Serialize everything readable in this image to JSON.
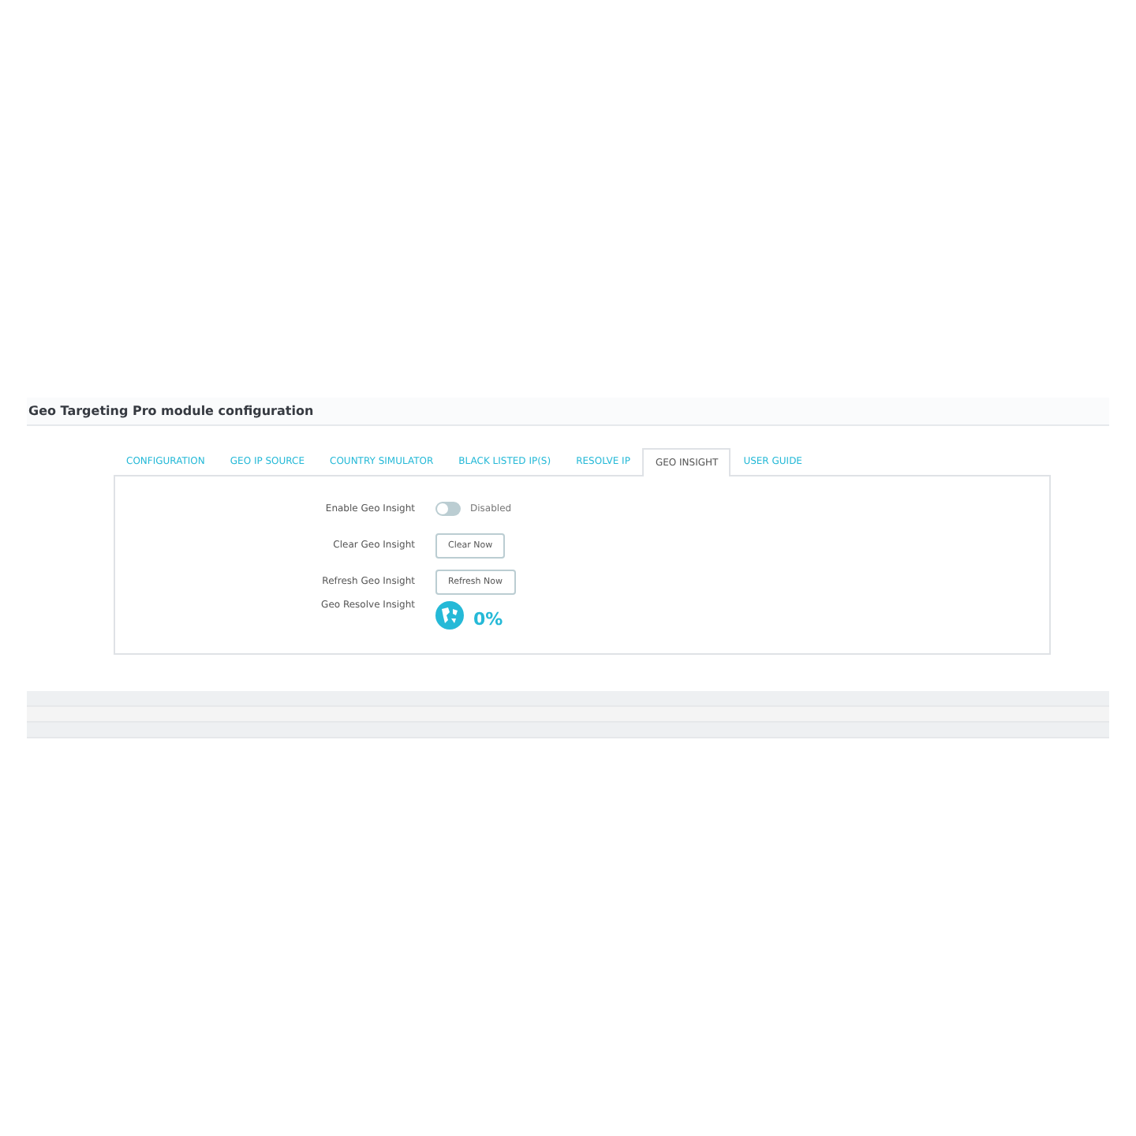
{
  "header": {
    "title": "Geo Targeting Pro module configuration"
  },
  "tabs": [
    {
      "label": "CONFIGURATION",
      "selected": false
    },
    {
      "label": "GEO IP SOURCE",
      "selected": false
    },
    {
      "label": "COUNTRY SIMULATOR",
      "selected": false
    },
    {
      "label": "BLACK LISTED IP(S)",
      "selected": false
    },
    {
      "label": "RESOLVE IP",
      "selected": false
    },
    {
      "label": "GEO INSIGHT",
      "selected": true
    },
    {
      "label": "USER GUIDE",
      "selected": false
    }
  ],
  "rows": [
    {
      "kind": "switch",
      "label": "Enable Geo Insight",
      "on": false,
      "state_text": "Disabled"
    },
    {
      "kind": "button",
      "label": "Clear Geo Insight",
      "button": "Clear Now"
    },
    {
      "kind": "button",
      "label": "Refresh Geo Insight",
      "button": "Refresh Now"
    },
    {
      "kind": "progress",
      "label": "Geo Resolve Insight",
      "value": "0%"
    }
  ]
}
